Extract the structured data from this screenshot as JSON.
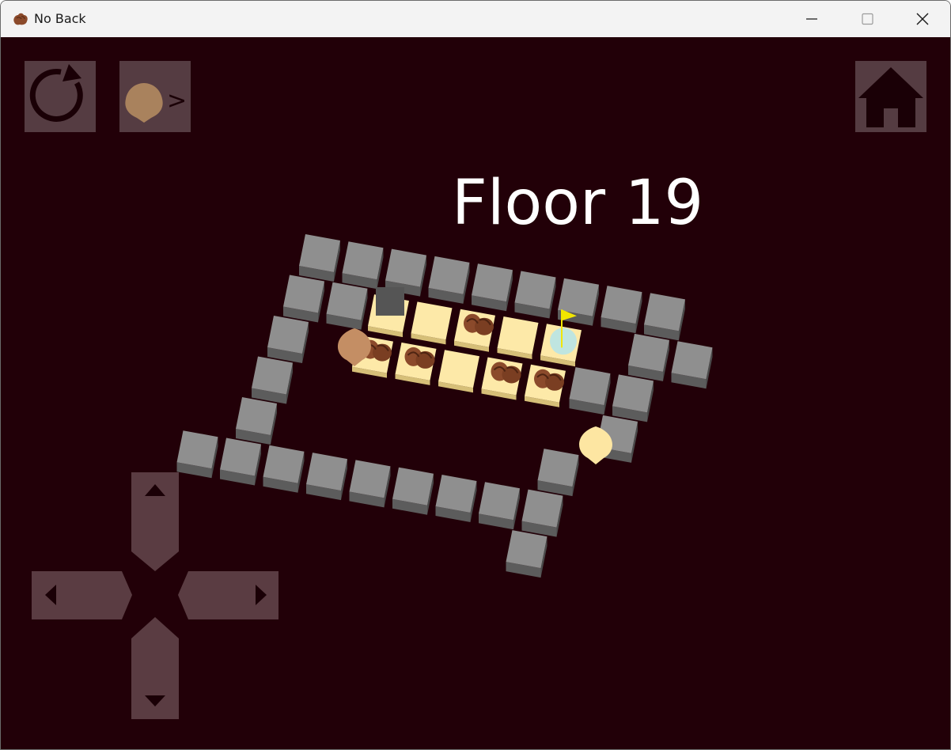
{
  "window": {
    "title": "No Back",
    "icon": "rock-icon",
    "controls": [
      "minimize-icon",
      "maximize-icon",
      "close-icon"
    ]
  },
  "hud": {
    "undo_icon": "undo-icon",
    "skip_icon": "skip-character-icon",
    "skip_arrow": ">",
    "home_icon": "home-icon"
  },
  "level": {
    "floor_label": "Floor 19"
  },
  "board": {
    "wall_color": "#8f8f8f",
    "floor_tile_color": "#fde9a8",
    "rock_color": "#8b4a2b",
    "player_color": "#c48e64",
    "second_character_color": "#fde6a2",
    "goal_color": "#bfe5e0",
    "flag_color": "#f2e600"
  },
  "dpad": {
    "up": "arrow-up-icon",
    "down": "arrow-down-icon",
    "left": "arrow-left-icon",
    "right": "arrow-right-icon"
  },
  "colors": {
    "background": "#220008",
    "hud_button": "#6f5d62"
  }
}
